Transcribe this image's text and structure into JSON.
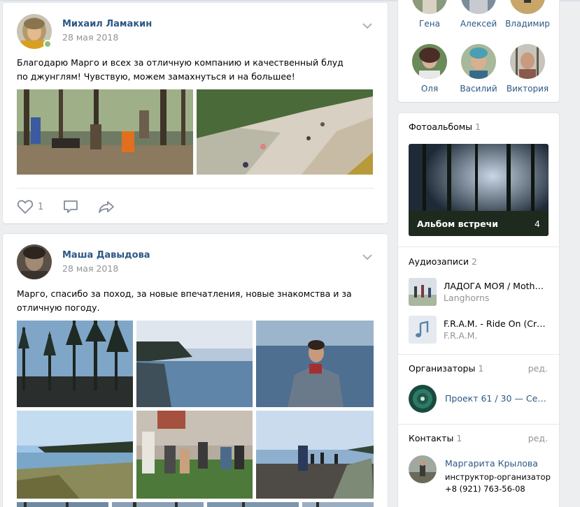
{
  "posts": [
    {
      "author": "Михаил Ламакин",
      "date": "28 мая 2018",
      "text": "Благодарю Марго и всех за отличную компанию и качественный блуд по джунглям! Чувствую, можем замахнуться и на большее!",
      "likes": "1",
      "online": true
    },
    {
      "author": "Маша Давыдова",
      "date": "28 мая 2018",
      "text": "Марго, спасибо за поход, за новые впечатления, новые знакомства и за отличную погоду."
    }
  ],
  "friends": [
    {
      "name": "Гена"
    },
    {
      "name": "Алексей"
    },
    {
      "name": "Владимир"
    },
    {
      "name": "Оля"
    },
    {
      "name": "Василий"
    },
    {
      "name": "Виктория"
    }
  ],
  "sidebar": {
    "albums": {
      "title": "Фотоальбомы",
      "count": "1",
      "album_title": "Альбом встречи",
      "album_count": "4"
    },
    "audio": {
      "title": "Аудиозаписи",
      "count": "2",
      "tracks": [
        {
          "title": "ЛАДОГА МОЯ / Mother O...",
          "artist": "Langhorns"
        },
        {
          "title": "F.R.A.M. - Ride On (Cruac...",
          "artist": "F.R.A.M."
        }
      ]
    },
    "organizers": {
      "title": "Организаторы",
      "count": "1",
      "edit": "ред.",
      "name": "Проект 61 / 30 — Север..."
    },
    "contacts": {
      "title": "Контакты",
      "count": "1",
      "edit": "ред.",
      "name": "Маргарита Крылова",
      "role": "инструктор-организатор",
      "phone": "+8 (921) 763-56-08"
    }
  },
  "colors": {
    "link": "#2a5885",
    "muted": "#939393",
    "page_bg": "#edeef0",
    "online": "#8ac176"
  },
  "icons": [
    "chevron-down-icon",
    "heart-icon",
    "comment-icon",
    "share-icon",
    "music-note-icon"
  ]
}
